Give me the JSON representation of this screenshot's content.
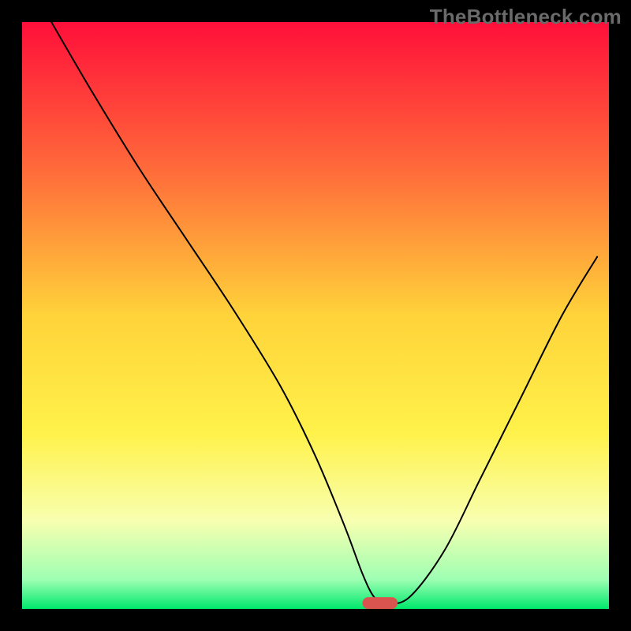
{
  "watermark": "TheBottleneck.com",
  "chart_data": {
    "type": "line",
    "title": "",
    "xlabel": "",
    "ylabel": "",
    "xlim": [
      0,
      100
    ],
    "ylim": [
      0,
      100
    ],
    "grid": false,
    "legend": false,
    "background": {
      "type": "vertical_gradient",
      "stops": [
        {
          "pos": 0.0,
          "color": "#ff0f3a"
        },
        {
          "pos": 0.25,
          "color": "#ff6a3a"
        },
        {
          "pos": 0.5,
          "color": "#ffd33a"
        },
        {
          "pos": 0.7,
          "color": "#fff24a"
        },
        {
          "pos": 0.85,
          "color": "#f8ffb0"
        },
        {
          "pos": 0.95,
          "color": "#9effb3"
        },
        {
          "pos": 1.0,
          "color": "#00e86c"
        }
      ]
    },
    "frame_color": "#000000",
    "frame_thickness_px": 28,
    "series": [
      {
        "name": "bottleneck_curve",
        "color": "#000000",
        "stroke_width": 2,
        "type": "line",
        "x": [
          5,
          12,
          20,
          28,
          36,
          44,
          50,
          55,
          58,
          60,
          62,
          66,
          72,
          78,
          85,
          92,
          98
        ],
        "y": [
          100,
          88,
          75,
          63,
          51,
          38,
          26,
          14,
          6,
          2,
          1,
          2,
          10,
          22,
          36,
          50,
          60
        ]
      }
    ],
    "annotations": [
      {
        "type": "pill",
        "name": "optimal_marker",
        "x_center": 61,
        "y_center": 1,
        "width": 6,
        "height": 2,
        "fill": "#d9534f"
      }
    ]
  }
}
